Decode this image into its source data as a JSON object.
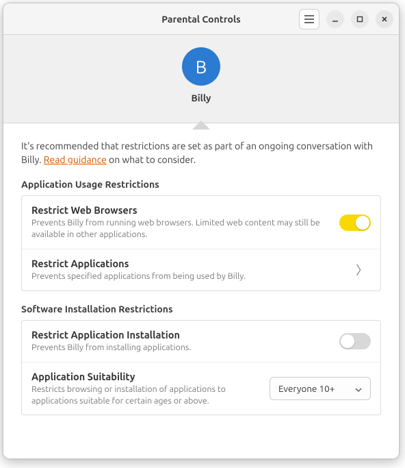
{
  "window": {
    "title": "Parental Controls"
  },
  "user": {
    "avatar_initial": "B",
    "name": "Billy"
  },
  "intro": {
    "prefix": "It's recommended that restrictions are set as part of an ongoing conversation with Billy. ",
    "link": "Read guidance",
    "suffix": " on what to consider."
  },
  "sections": {
    "usage": {
      "title": "Application Usage Restrictions",
      "rows": {
        "web": {
          "title": "Restrict Web Browsers",
          "subtitle": "Prevents Billy from running web browsers. Limited web content may still be available in other applications.",
          "toggle": true
        },
        "apps": {
          "title": "Restrict Applications",
          "subtitle": "Prevents specified applications from being used by Billy."
        }
      }
    },
    "install": {
      "title": "Software Installation Restrictions",
      "rows": {
        "install": {
          "title": "Restrict Application Installation",
          "subtitle": "Prevents Billy from installing applications.",
          "toggle": false
        },
        "suitability": {
          "title": "Application Suitability",
          "subtitle": "Restricts browsing or installation of applications to applications suitable for certain ages or above.",
          "value": "Everyone 10+"
        }
      }
    }
  }
}
